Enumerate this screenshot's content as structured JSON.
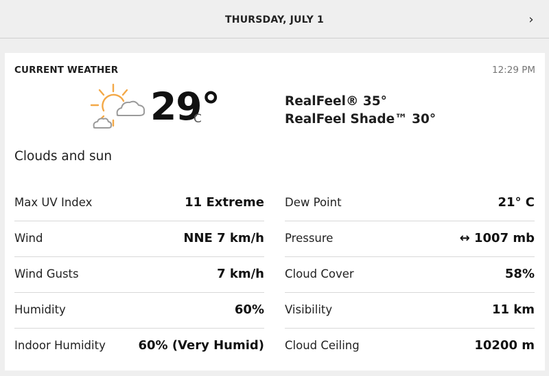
{
  "header": {
    "date": "THURSDAY, JULY 1",
    "next_icon": "chevron-right-icon"
  },
  "current": {
    "title": "CURRENT WEATHER",
    "time": "12:29 PM",
    "icon": "clouds-and-sun-icon",
    "temperature": "29°",
    "unit": "C",
    "realfeel": "RealFeel® 35°",
    "realfeel_shade": "RealFeel Shade™ 30°",
    "phrase": "Clouds and sun"
  },
  "details_left": [
    {
      "label": "Max UV Index",
      "value": "11 Extreme"
    },
    {
      "label": "Wind",
      "value": "NNE 7 km/h"
    },
    {
      "label": "Wind Gusts",
      "value": "7 km/h"
    },
    {
      "label": "Humidity",
      "value": "60%"
    },
    {
      "label": "Indoor Humidity",
      "value": "60% (Very Humid)"
    }
  ],
  "details_right": [
    {
      "label": "Dew Point",
      "value": "21° C"
    },
    {
      "label": "Pressure",
      "value": "↔ 1007 mb"
    },
    {
      "label": "Cloud Cover",
      "value": "58%"
    },
    {
      "label": "Visibility",
      "value": "11 km"
    },
    {
      "label": "Cloud Ceiling",
      "value": "10200 m"
    }
  ],
  "colors": {
    "sun": "#f3a847",
    "cloud": "#9a9a9a",
    "background": "#efefef",
    "card": "#ffffff"
  }
}
